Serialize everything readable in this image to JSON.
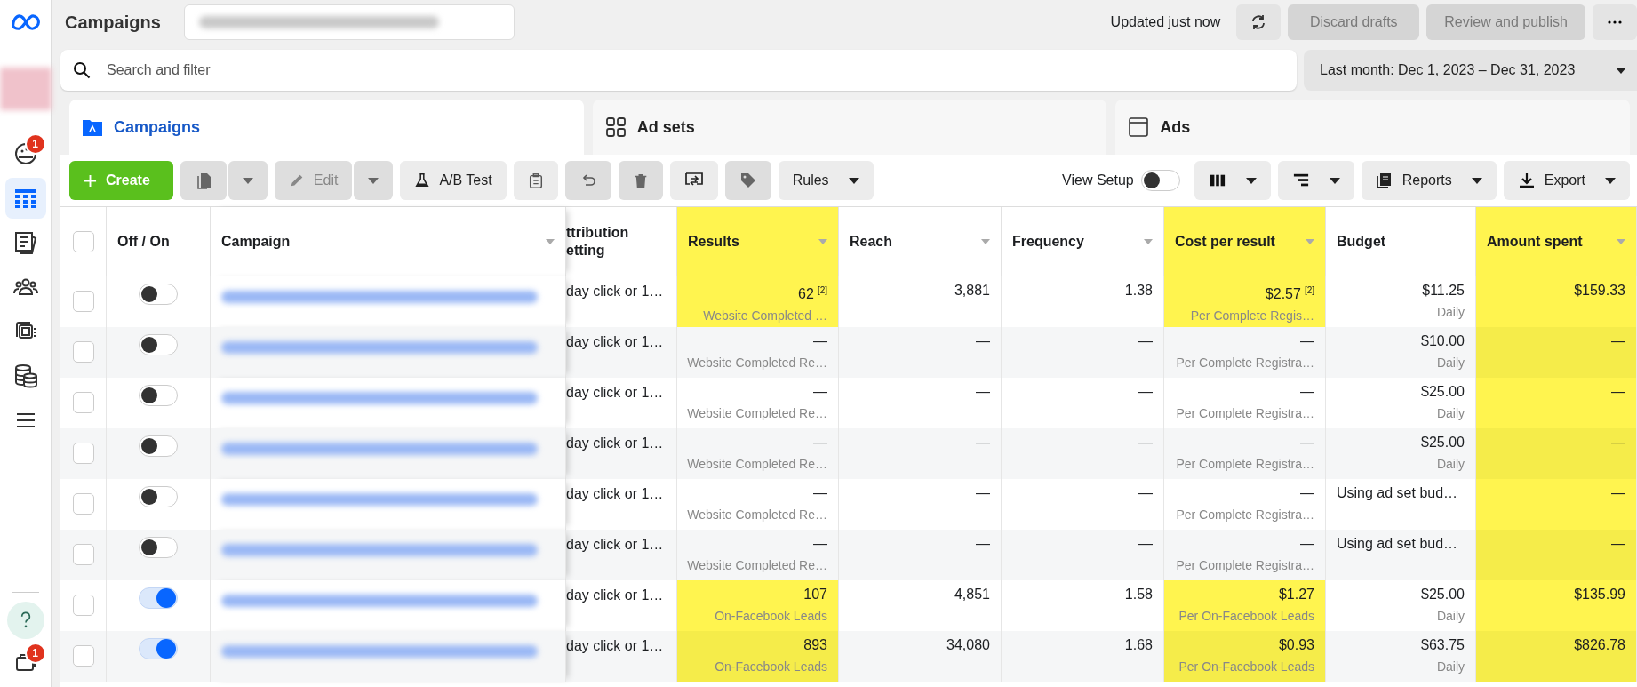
{
  "sidebar": {
    "items": [
      {
        "kind": "dashboard",
        "selected": false,
        "badge": "1"
      },
      {
        "kind": "table",
        "selected": true
      },
      {
        "kind": "pages",
        "selected": false
      },
      {
        "kind": "people",
        "selected": false
      },
      {
        "kind": "catalog",
        "selected": false
      },
      {
        "kind": "database",
        "selected": false
      },
      {
        "kind": "menu",
        "selected": false
      }
    ],
    "bottom": [
      {
        "kind": "help"
      },
      {
        "kind": "inbox",
        "badge": "1"
      }
    ]
  },
  "header": {
    "title": "Campaigns",
    "status": "Updated just now",
    "buttons": [
      {
        "label": "Discard drafts",
        "disabled": true
      },
      {
        "label": "Review and publish",
        "disabled": true
      }
    ]
  },
  "search": {
    "placeholder": "Search and filter"
  },
  "date_range": "Last month: Dec 1, 2023 – Dec 31, 2023",
  "tabs": [
    {
      "kind": "campaigns",
      "label": "Campaigns",
      "selected": true
    },
    {
      "kind": "adsets",
      "label": "Ad sets",
      "selected": false
    },
    {
      "kind": "ads",
      "label": "Ads",
      "selected": false
    }
  ],
  "toolbar": {
    "left": [
      {
        "kind": "create",
        "label": "Create",
        "disabled": false
      },
      {
        "kind": "duplicate",
        "disabled": true,
        "dropdown": true
      },
      {
        "kind": "edit",
        "label": "Edit",
        "disabled": true,
        "dropdown": true
      },
      {
        "kind": "ab",
        "label": "A/B Test",
        "disabled": false
      },
      {
        "kind": "clipboard",
        "disabled": false
      },
      {
        "kind": "undo",
        "disabled": true
      },
      {
        "kind": "delete",
        "disabled": true
      },
      {
        "kind": "swap",
        "disabled": false
      },
      {
        "kind": "tag",
        "disabled": true
      },
      {
        "kind": "rules",
        "label": "Rules",
        "disabled": false
      }
    ],
    "view_setup": {
      "label": "View Setup",
      "on": false
    },
    "right": [
      {
        "kind": "columns"
      },
      {
        "kind": "breakdown"
      },
      {
        "kind": "reports",
        "label": "Reports"
      },
      {
        "kind": "export",
        "label": "Export"
      }
    ]
  },
  "table": {
    "header_checked": false,
    "columns": [
      {
        "label": "Off / On",
        "sortable": false,
        "highlighted": false
      },
      {
        "label": "Campaign",
        "sortable": true,
        "highlighted": false
      },
      {
        "label": "ttribution\netting",
        "sortable": false,
        "highlighted": false
      },
      {
        "label": "Results",
        "sortable": true,
        "highlighted": true
      },
      {
        "label": "Reach",
        "sortable": true,
        "highlighted": false
      },
      {
        "label": "Frequency",
        "sortable": true,
        "highlighted": false
      },
      {
        "label": "Cost per result",
        "sortable": true,
        "highlighted": true
      },
      {
        "label": "Budget",
        "sortable": false,
        "highlighted": false
      },
      {
        "label": "Amount spent",
        "sortable": true,
        "highlighted": true
      }
    ],
    "rows": [
      {
        "checked": false,
        "on": false,
        "attribution": "day click or 1…",
        "results": {
          "value": "62$^{[2]}$",
          "label": "Website Completed …",
          "highlighted": true
        },
        "reach": "3,881",
        "frequency": "1.38",
        "cost": {
          "value": "$2.57$^{[2]}$",
          "label": "Per Complete Regis…",
          "highlighted": true
        },
        "budget": {
          "value": "$11.25",
          "label": "Daily"
        },
        "amount_spent": "$159.33"
      },
      {
        "checked": false,
        "on": false,
        "attribution": "day click or 1…",
        "results": {
          "value": "—",
          "label": "Website Completed Re…",
          "highlighted": false
        },
        "reach": "—",
        "frequency": "—",
        "cost": {
          "value": "—",
          "label": "Per Complete Registra…",
          "highlighted": false
        },
        "budget": {
          "value": "$10.00",
          "label": "Daily"
        },
        "amount_spent": "—"
      },
      {
        "checked": false,
        "on": false,
        "attribution": "day click or 1…",
        "results": {
          "value": "—",
          "label": "Website Completed Re…",
          "highlighted": false
        },
        "reach": "—",
        "frequency": "—",
        "cost": {
          "value": "—",
          "label": "Per Complete Registra…",
          "highlighted": false
        },
        "budget": {
          "value": "$25.00",
          "label": "Daily"
        },
        "amount_spent": "—"
      },
      {
        "checked": false,
        "on": false,
        "attribution": "day click or 1…",
        "results": {
          "value": "—",
          "label": "Website Completed Re…",
          "highlighted": false
        },
        "reach": "—",
        "frequency": "—",
        "cost": {
          "value": "—",
          "label": "Per Complete Registra…",
          "highlighted": false
        },
        "budget": {
          "value": "$25.00",
          "label": "Daily"
        },
        "amount_spent": "—"
      },
      {
        "checked": false,
        "on": false,
        "attribution": "day click or 1…",
        "results": {
          "value": "—",
          "label": "Website Completed Re…",
          "highlighted": false
        },
        "reach": "—",
        "frequency": "—",
        "cost": {
          "value": "—",
          "label": "Per Complete Registra…",
          "highlighted": false
        },
        "budget": {
          "value": "Using ad set bud…"
        },
        "amount_spent": "—"
      },
      {
        "checked": false,
        "on": false,
        "attribution": "day click or 1…",
        "results": {
          "value": "—",
          "label": "Website Completed Re…",
          "highlighted": false
        },
        "reach": "—",
        "frequency": "—",
        "cost": {
          "value": "—",
          "label": "Per Complete Registra…",
          "highlighted": false
        },
        "budget": {
          "value": "Using ad set bud…"
        },
        "amount_spent": "—"
      },
      {
        "checked": false,
        "on": true,
        "attribution": "day click or 1…",
        "results": {
          "value": "107",
          "label": "On-Facebook Leads",
          "highlighted": true
        },
        "reach": "4,851",
        "frequency": "1.58",
        "cost": {
          "value": "$1.27",
          "label": "Per On-Facebook Leads",
          "highlighted": true
        },
        "budget": {
          "value": "$25.00",
          "label": "Daily"
        },
        "amount_spent": "$135.99"
      },
      {
        "checked": false,
        "on": true,
        "attribution": "day click or 1…",
        "results": {
          "value": "893",
          "label": "On-Facebook Leads",
          "highlighted": true
        },
        "reach": "34,080",
        "frequency": "1.68",
        "cost": {
          "value": "$0.93",
          "label": "Per On-Facebook Leads",
          "highlighted": true
        },
        "budget": {
          "value": "$63.75",
          "label": "Daily"
        },
        "amount_spent": "$826.78"
      }
    ]
  }
}
